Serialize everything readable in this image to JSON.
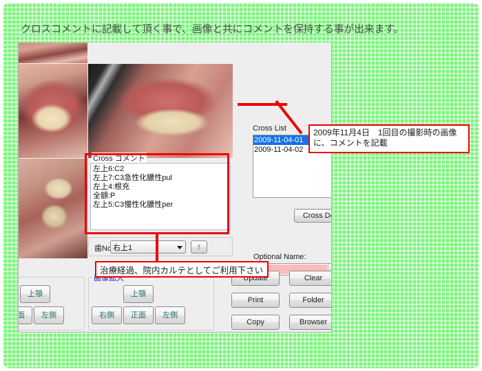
{
  "heading": "クロスコメントに記載して頂く事で、画像と共にコメントを保持する事が出来ます。",
  "colors": {
    "background_green": "#7bf47b",
    "annotation_red": "#ee0000",
    "selection_blue": "#1573e6",
    "optional_name_field": "#fcbcbc",
    "group_label_blue": "#2222bb",
    "button_text_teal": "#1d6c6c"
  },
  "cross_list": {
    "label": "Cross List",
    "items": [
      {
        "text": "2009-11-04-01",
        "selected": true
      },
      {
        "text": "2009-11-04-02",
        "selected": false
      }
    ],
    "delete_button": "Cross Del"
  },
  "optional_name": {
    "label": "Optional Name:",
    "value": "",
    "arrow_icon": "chevron-down-icon"
  },
  "cross_comment": {
    "label": "Cross コメント",
    "lines": [
      "左上6:C2",
      "左上7:C3急性化膿性pul",
      "左上4:根充",
      "全額:P",
      "左上5:C3慢性化膿性per"
    ]
  },
  "tooth": {
    "label": "歯No.",
    "value": "右上1",
    "arrow_icon": "chevron-down-icon",
    "up_button": "↑"
  },
  "image_zoom_group": {
    "label": "画像拡大",
    "buttons": {
      "upper": "上顎",
      "right": "右側",
      "center": "正面",
      "left": "左側"
    }
  },
  "left_group": {
    "buttons": {
      "upper": "上顎",
      "center": "正面",
      "left": "左側"
    }
  },
  "actions": {
    "update": "Update",
    "clear": "Clear",
    "print": "Print",
    "folder": "Folder",
    "copy": "Copy",
    "browser": "Browser"
  },
  "annotations": {
    "cross_note_line1": "2009年11月4日　1回目の撮影時の画像",
    "cross_note_line2": "に、コメントを記載",
    "usage_note": "治療経過、院内カルテとしてご利用下さい"
  },
  "photos": {
    "upper_left": "intraoral-photo-upper-left",
    "front": "intraoral-photo-front",
    "lower_left": "intraoral-photo-lower-left",
    "side": "intraoral-photo-side-view"
  }
}
